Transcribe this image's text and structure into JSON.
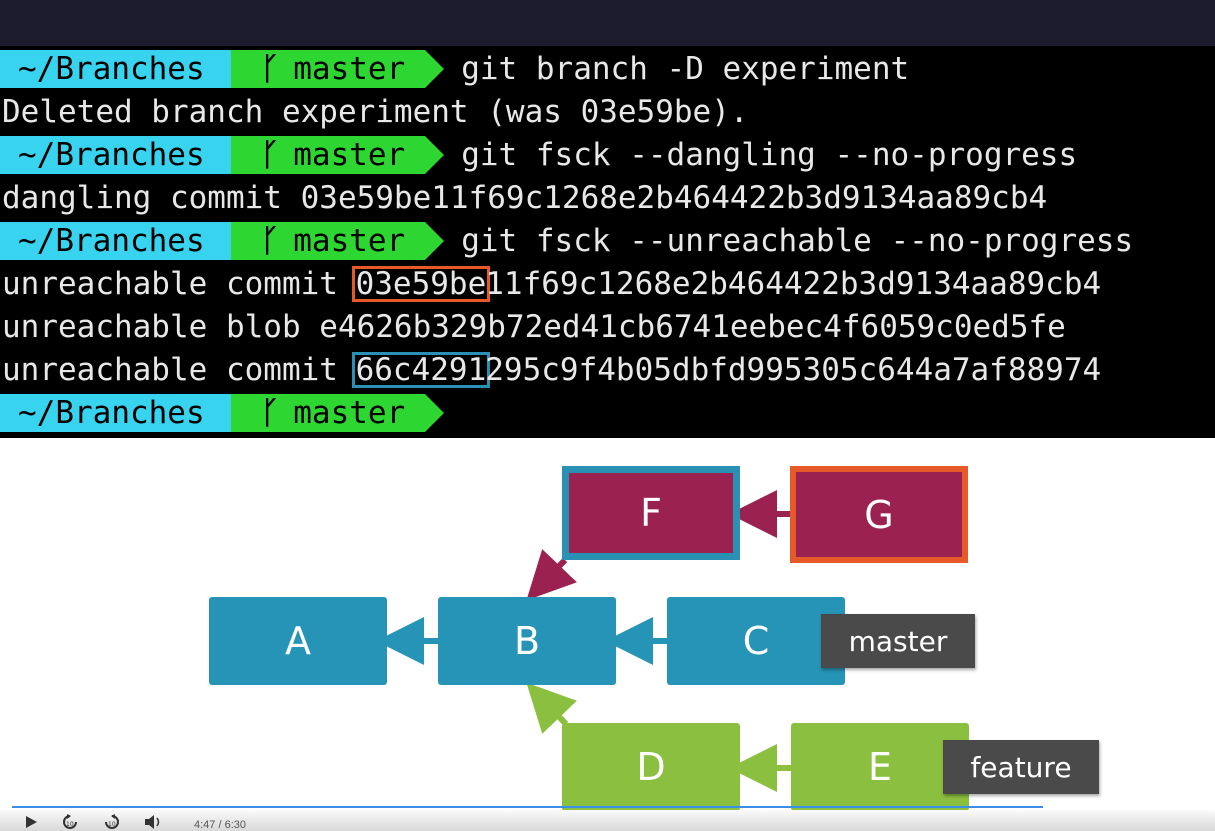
{
  "terminal": {
    "prompt_dir": "~/Branches",
    "prompt_branch": "master",
    "branch_glyph": "ᚴ",
    "cmd1": "git branch -D experiment",
    "out1": "Deleted branch experiment (was 03e59be).",
    "cmd2": "git fsck --dangling --no-progress",
    "out2": "dangling commit 03e59be11f69c1268e2b464422b3d9134aa89cb4",
    "cmd3": "git fsck --unreachable --no-progress",
    "out3_prefix": "unreachable commit ",
    "out3_hl": "03e59be",
    "out3_rest": "11f69c1268e2b464422b3d9134aa89cb4",
    "out4": "unreachable blob e4626b329b72ed41cb6741eebec4f6059c0ed5fe",
    "out5_prefix": "unreachable commit ",
    "out5_hl": "66c4291",
    "out5_rest": "295c9f4b05dbfd995305c644a7af88974"
  },
  "diagram": {
    "nodes": {
      "A": "A",
      "B": "B",
      "C": "C",
      "D": "D",
      "E": "E",
      "F": "F",
      "G": "G"
    },
    "tags": {
      "master": "master",
      "feature": "feature"
    },
    "colors": {
      "teal": "#2694b6",
      "green": "#8bbf3f",
      "maroon": "#9a2150",
      "orange": "#e65a2a",
      "blue_outline": "#2a90b4"
    }
  },
  "player": {
    "time": "4:47 / 6:30",
    "icons": [
      "play-icon",
      "rewind-10-icon",
      "forward-10-icon",
      "volume-icon"
    ],
    "progress": 0.85
  }
}
